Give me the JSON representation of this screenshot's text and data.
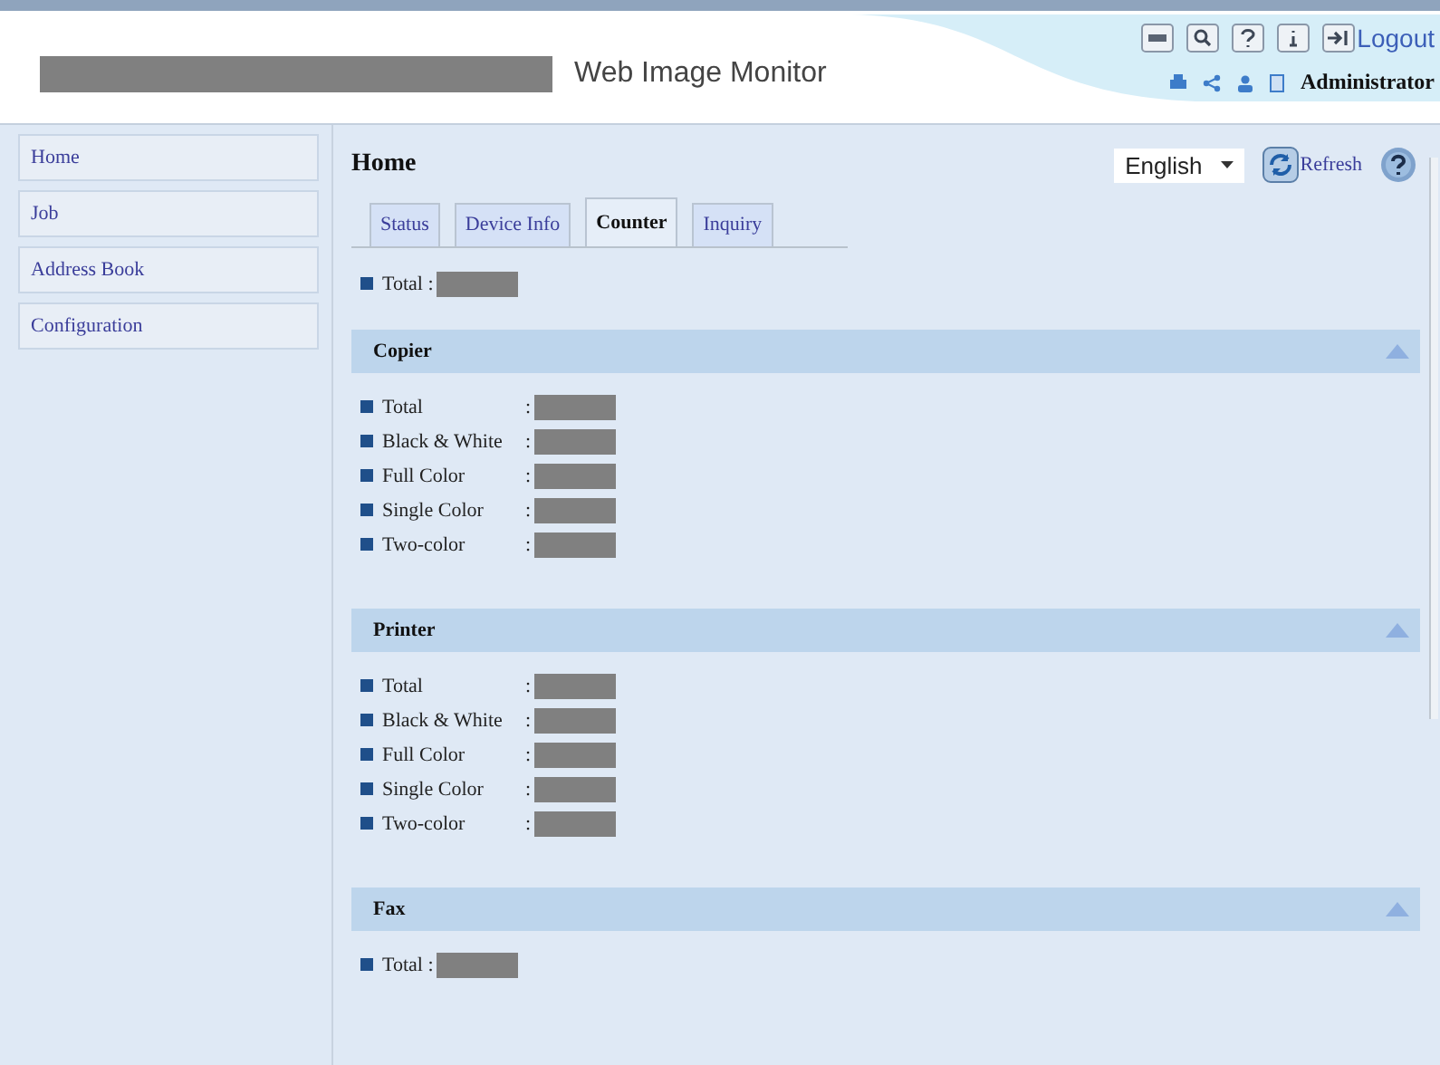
{
  "header": {
    "title": "Web Image Monitor",
    "logout": "Logout",
    "user": "Administrator"
  },
  "sidebar": {
    "items": [
      {
        "label": "Home"
      },
      {
        "label": "Job"
      },
      {
        "label": "Address Book"
      },
      {
        "label": "Configuration"
      }
    ]
  },
  "page": {
    "title": "Home",
    "language": "English",
    "refresh": "Refresh"
  },
  "tabs": [
    {
      "label": "Status",
      "selected": false
    },
    {
      "label": "Device Info",
      "selected": false
    },
    {
      "label": "Counter",
      "selected": true
    },
    {
      "label": "Inquiry",
      "selected": false
    }
  ],
  "total": {
    "label": "Total :"
  },
  "sections": [
    {
      "title": "Copier",
      "expanded": true,
      "items": [
        {
          "label": "Total",
          "separator": ":"
        },
        {
          "label": "Black & White",
          "separator": ":"
        },
        {
          "label": "Full Color",
          "separator": ":"
        },
        {
          "label": "Single Color",
          "separator": ":"
        },
        {
          "label": "Two-color",
          "separator": ":"
        }
      ]
    },
    {
      "title": "Printer",
      "expanded": true,
      "items": [
        {
          "label": "Total",
          "separator": ":"
        },
        {
          "label": "Black & White",
          "separator": ":"
        },
        {
          "label": "Full Color",
          "separator": ":"
        },
        {
          "label": "Single Color",
          "separator": ":"
        },
        {
          "label": "Two-color",
          "separator": ":"
        }
      ]
    },
    {
      "title": "Fax",
      "expanded": true,
      "items": [
        {
          "label": "Total :"
        }
      ]
    }
  ]
}
